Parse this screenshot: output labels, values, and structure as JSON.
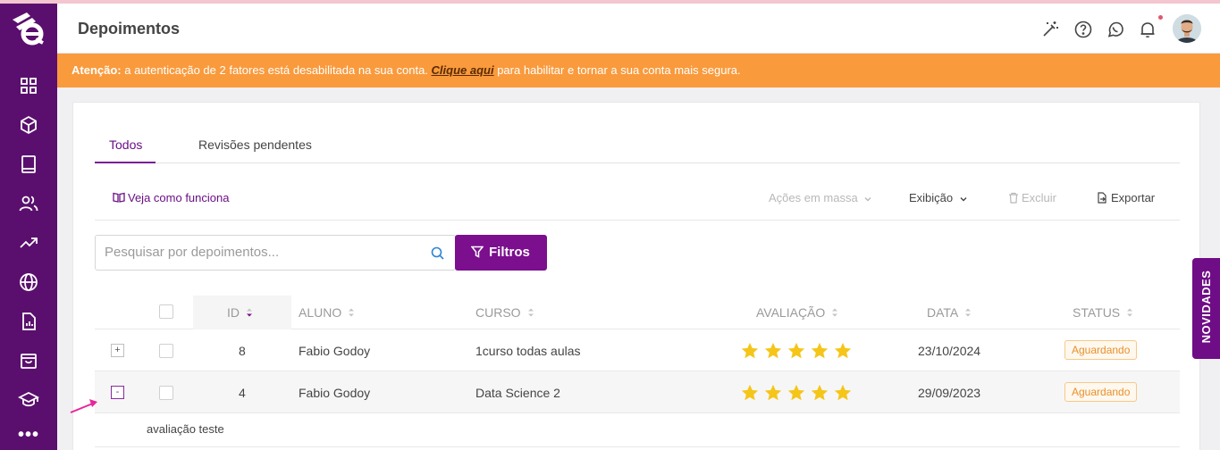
{
  "header": {
    "title": "Depoimentos"
  },
  "alert": {
    "prefix": "Atenção:",
    "text": " a autenticação de 2 fatores está desabilitada na sua conta. ",
    "link": "Clique aqui",
    "suffix": " para habilitar e tornar a sua conta mais segura."
  },
  "tabs": [
    {
      "label": "Todos",
      "active": true
    },
    {
      "label": "Revisões pendentes",
      "active": false
    }
  ],
  "toolbar": {
    "help_link": "Veja como funciona",
    "bulk_actions": "Ações em massa",
    "display": "Exibição",
    "delete": "Excluir",
    "export": "Exportar"
  },
  "search": {
    "placeholder": "Pesquisar por depoimentos...",
    "value": ""
  },
  "filters_button": "Filtros",
  "table": {
    "columns": [
      "ID",
      "ALUNO",
      "CURSO",
      "AVALIAÇÃO",
      "DATA",
      "STATUS"
    ],
    "rows": [
      {
        "expand": "+",
        "id": "8",
        "student": "Fabio Godoy",
        "course": "1curso todas aulas",
        "rating": 5,
        "date": "23/10/2024",
        "status": "Aguardando"
      },
      {
        "expand": "-",
        "id": "4",
        "student": "Fabio Godoy",
        "course": "Data Science 2",
        "rating": 5,
        "date": "29/09/2023",
        "status": "Aguardando"
      }
    ],
    "expanded_detail": "avaliação teste"
  },
  "side_tab": "NOVIDADES",
  "sidebar": {
    "icons": [
      "grid-icon",
      "cube-icon",
      "book-icon",
      "users-icon",
      "trending-icon",
      "globe-icon",
      "report-icon",
      "shopping-bag-icon",
      "graduation-cap-icon"
    ],
    "more": "•••"
  },
  "colors": {
    "sidebar": "#5a0f6e",
    "accent": "#7b0f8e",
    "alert": "#f99a3c",
    "star": "#f5c518",
    "status": "#e8902a"
  }
}
